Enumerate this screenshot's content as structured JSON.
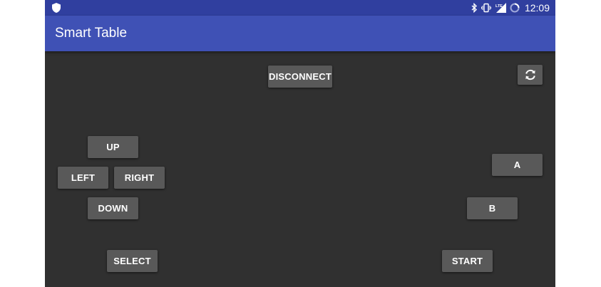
{
  "status_bar": {
    "time": "12:09",
    "icons": [
      "shield-icon",
      "bluetooth-icon",
      "vibrate-icon",
      "lte-signal-icon",
      "battery-charging-icon"
    ]
  },
  "app": {
    "title": "Smart Table"
  },
  "controls": {
    "disconnect_label": "DISCONNECT",
    "sync_icon": "sync-icon",
    "up_label": "UP",
    "left_label": "LEFT",
    "right_label": "RIGHT",
    "down_label": "DOWN",
    "a_label": "A",
    "b_label": "B",
    "select_label": "SELECT",
    "start_label": "START"
  },
  "colors": {
    "status_bar": "#303F9F",
    "app_bar": "#3F51B5",
    "background": "#303030",
    "button": "#595959"
  }
}
